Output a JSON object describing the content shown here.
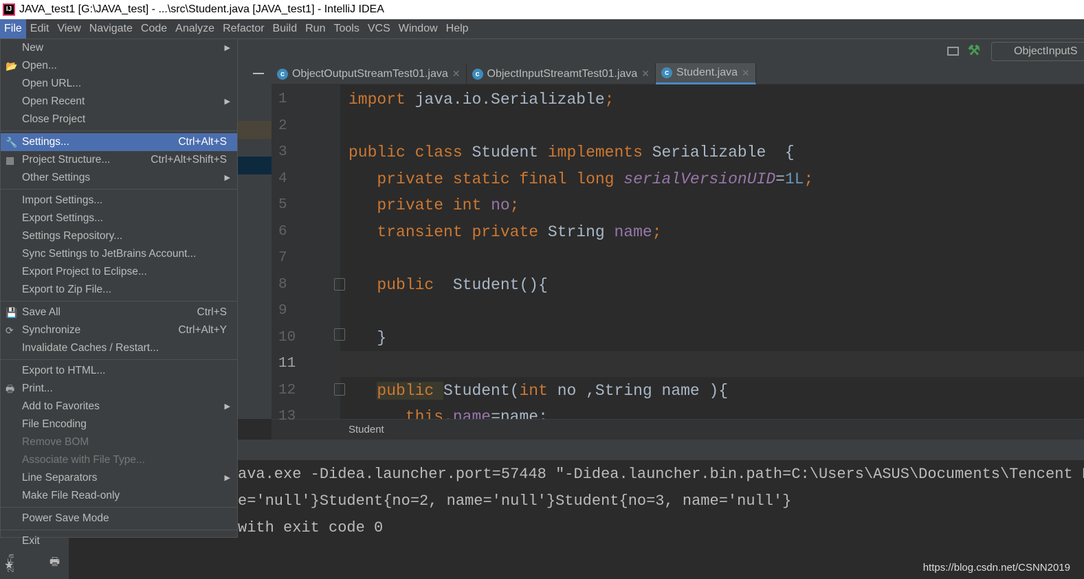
{
  "title": "JAVA_test1 [G:\\JAVA_test] - ...\\src\\Student.java [JAVA_test1] - IntelliJ IDEA",
  "menubar": [
    "File",
    "Edit",
    "View",
    "Navigate",
    "Code",
    "Analyze",
    "Refactor",
    "Build",
    "Run",
    "Tools",
    "VCS",
    "Window",
    "Help"
  ],
  "toolbar": {
    "run_config": "ObjectInputS"
  },
  "tabs": [
    {
      "label": "ObjectOutputStreamTest01.java"
    },
    {
      "label": "ObjectInputStreamtTest01.java"
    },
    {
      "label": "Student.java",
      "active": true
    }
  ],
  "file_menu": [
    {
      "label": "New",
      "submenu": true
    },
    {
      "label": "Open...",
      "icon": "folder-icon"
    },
    {
      "label": "Open URL..."
    },
    {
      "label": "Open Recent",
      "submenu": true
    },
    {
      "label": "Close Project",
      "sep_after": true
    },
    {
      "label": "Settings...",
      "shortcut": "Ctrl+Alt+S",
      "icon": "wrench-icon",
      "selected": true
    },
    {
      "label": "Project Structure...",
      "shortcut": "Ctrl+Alt+Shift+S",
      "icon": "project-structure-icon"
    },
    {
      "label": "Other Settings",
      "submenu": true,
      "sep_after": true
    },
    {
      "label": "Import Settings..."
    },
    {
      "label": "Export Settings..."
    },
    {
      "label": "Settings Repository..."
    },
    {
      "label": "Sync Settings to JetBrains Account..."
    },
    {
      "label": "Export Project to Eclipse..."
    },
    {
      "label": "Export to Zip File...",
      "sep_after": true
    },
    {
      "label": "Save All",
      "shortcut": "Ctrl+S",
      "icon": "save-icon"
    },
    {
      "label": "Synchronize",
      "shortcut": "Ctrl+Alt+Y",
      "icon": "sync-icon"
    },
    {
      "label": "Invalidate Caches / Restart...",
      "sep_after": true
    },
    {
      "label": "Export to HTML..."
    },
    {
      "label": "Print...",
      "icon": "print-icon"
    },
    {
      "label": "Add to Favorites",
      "submenu": true
    },
    {
      "label": "File Encoding"
    },
    {
      "label": "Remove BOM",
      "disabled": true
    },
    {
      "label": "Associate with File Type...",
      "disabled": true
    },
    {
      "label": "Line Separators",
      "submenu": true
    },
    {
      "label": "Make File Read-only",
      "sep_after": true
    },
    {
      "label": "Power Save Mode",
      "sep_after": true
    },
    {
      "label": "Exit"
    }
  ],
  "code": [
    {
      "n": "1",
      "t": [
        [
          "k",
          "import "
        ],
        [
          "",
          "java.io.Serializable"
        ],
        [
          "k",
          ";"
        ]
      ]
    },
    {
      "n": "2",
      "t": []
    },
    {
      "n": "3",
      "t": [
        [
          "k",
          "public class "
        ],
        [
          "",
          "Student "
        ],
        [
          "k",
          "implements "
        ],
        [
          "",
          "Serializable  {"
        ]
      ]
    },
    {
      "n": "4",
      "t": [
        [
          "",
          "   "
        ],
        [
          "k",
          "private static final long "
        ],
        [
          "fi",
          "serialVersionUID"
        ],
        [
          "",
          "="
        ],
        [
          "n",
          "1L"
        ],
        [
          "k",
          ";"
        ]
      ]
    },
    {
      "n": "5",
      "t": [
        [
          "",
          "   "
        ],
        [
          "k",
          "private int "
        ],
        [
          "f",
          "no"
        ],
        [
          "k",
          ";"
        ]
      ]
    },
    {
      "n": "6",
      "t": [
        [
          "",
          "   "
        ],
        [
          "k",
          "transient private "
        ],
        [
          "",
          "String "
        ],
        [
          "f",
          "name"
        ],
        [
          "k",
          ";"
        ]
      ]
    },
    {
      "n": "7",
      "t": []
    },
    {
      "n": "8",
      "t": [
        [
          "",
          "   "
        ],
        [
          "k",
          "public  "
        ],
        [
          "",
          "Student(){"
        ]
      ]
    },
    {
      "n": "9",
      "t": []
    },
    {
      "n": "10",
      "t": [
        [
          "",
          "   }"
        ]
      ]
    },
    {
      "n": "11",
      "t": []
    },
    {
      "n": "12",
      "t": [
        [
          "",
          "   "
        ],
        [
          "k",
          "public "
        ],
        [
          "",
          "Student("
        ],
        [
          "k",
          "int "
        ],
        [
          "",
          "no ,String name ){"
        ]
      ]
    },
    {
      "n": "13",
      "t": [
        [
          "",
          "      "
        ],
        [
          "k",
          "this"
        ],
        [
          "",
          "."
        ],
        [
          "f",
          "name"
        ],
        [
          "",
          "=name;"
        ]
      ]
    }
  ],
  "breadcrumb": "Student",
  "console": [
    "ava.exe -Didea.launcher.port=57448 \"-Didea.launcher.bin.path=C:\\Users\\ASUS\\Documents\\Tencent Fi",
    "e='null'}Student{no=2, name='null'}Student{no=3, name='null'}",
    "with exit code 0"
  ],
  "sidebar_label": "2: Fa",
  "watermark": "https://blog.csdn.net/CSNN2019"
}
